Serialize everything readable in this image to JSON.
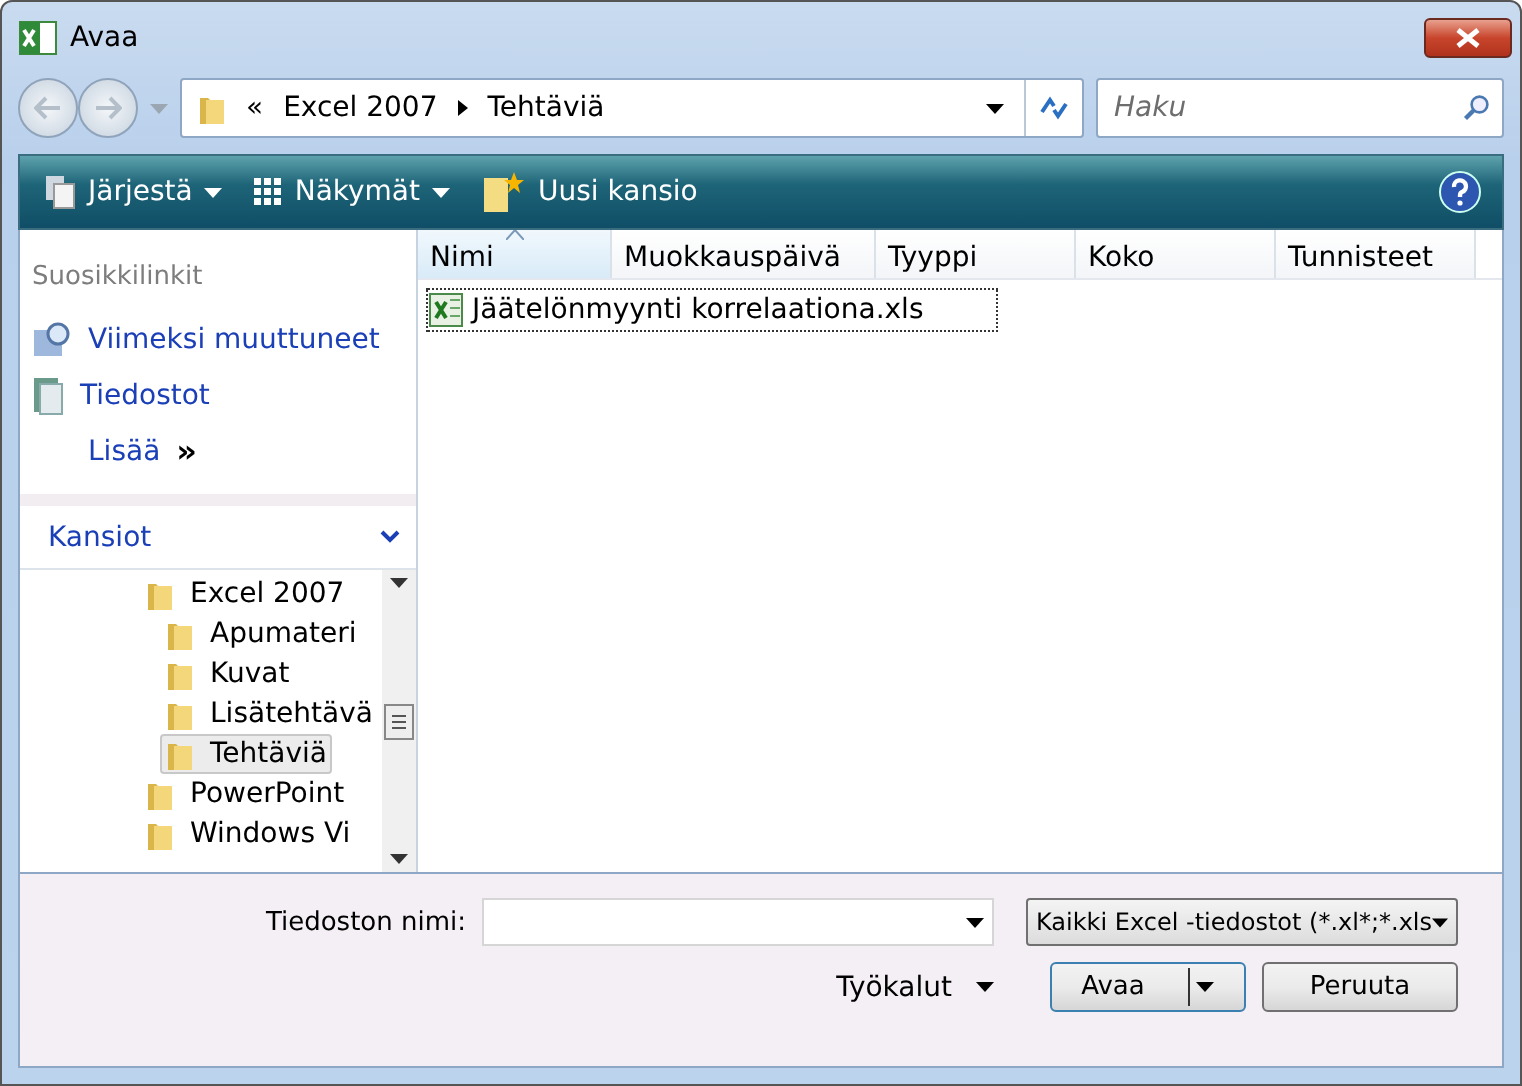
{
  "window": {
    "title": "Avaa"
  },
  "address": {
    "prefix": "«",
    "crumbs": [
      "Excel 2007",
      "Tehtäviä"
    ]
  },
  "search": {
    "placeholder": "Haku"
  },
  "toolbar": [
    {
      "label": "Järjestä",
      "kind": "organize"
    },
    {
      "label": "Näkymät",
      "kind": "views"
    },
    {
      "label": "Uusi kansio",
      "kind": "newfolder"
    }
  ],
  "favorites": {
    "title": "Suosikkilinkit",
    "items": [
      {
        "label": "Viimeksi muuttuneet",
        "kind": "recent"
      },
      {
        "label": "Tiedostot",
        "kind": "documents"
      },
      {
        "label": "Lisää",
        "kind": "more",
        "suffix": "»"
      }
    ]
  },
  "folders": {
    "title": "Kansiot",
    "expanded": true,
    "items": [
      {
        "label": "Excel 2007",
        "selected": false,
        "children": [
          {
            "label": "Apumateri",
            "selected": false
          },
          {
            "label": "Kuvat",
            "selected": false
          },
          {
            "label": "Lisätehtävä",
            "selected": false
          },
          {
            "label": "Tehtäviä",
            "selected": true
          }
        ]
      },
      {
        "label": "PowerPoint",
        "selected": false
      },
      {
        "label": "Windows Vi",
        "selected": false
      }
    ]
  },
  "table": {
    "columns": [
      {
        "label": "Nimi",
        "sorted": true
      },
      {
        "label": "Muokkauspäivä",
        "sorted": false
      },
      {
        "label": "Tyyppi",
        "sorted": false
      },
      {
        "label": "Koko",
        "sorted": false
      },
      {
        "label": "Tunnisteet",
        "sorted": false
      }
    ],
    "rows": [
      {
        "name": "Jäätelönmyynti korrelaationa.xls",
        "selected": true
      }
    ]
  },
  "filename": {
    "label": "Tiedoston nimi:"
  },
  "filter": {
    "value": "Kaikki Excel -tiedostot (*.xl*;*.xls"
  },
  "tools": {
    "label": "Työkalut"
  },
  "buttons": [
    {
      "label": "Avaa",
      "kind": "split"
    },
    {
      "label": "Peruuta",
      "kind": "plain"
    }
  ]
}
